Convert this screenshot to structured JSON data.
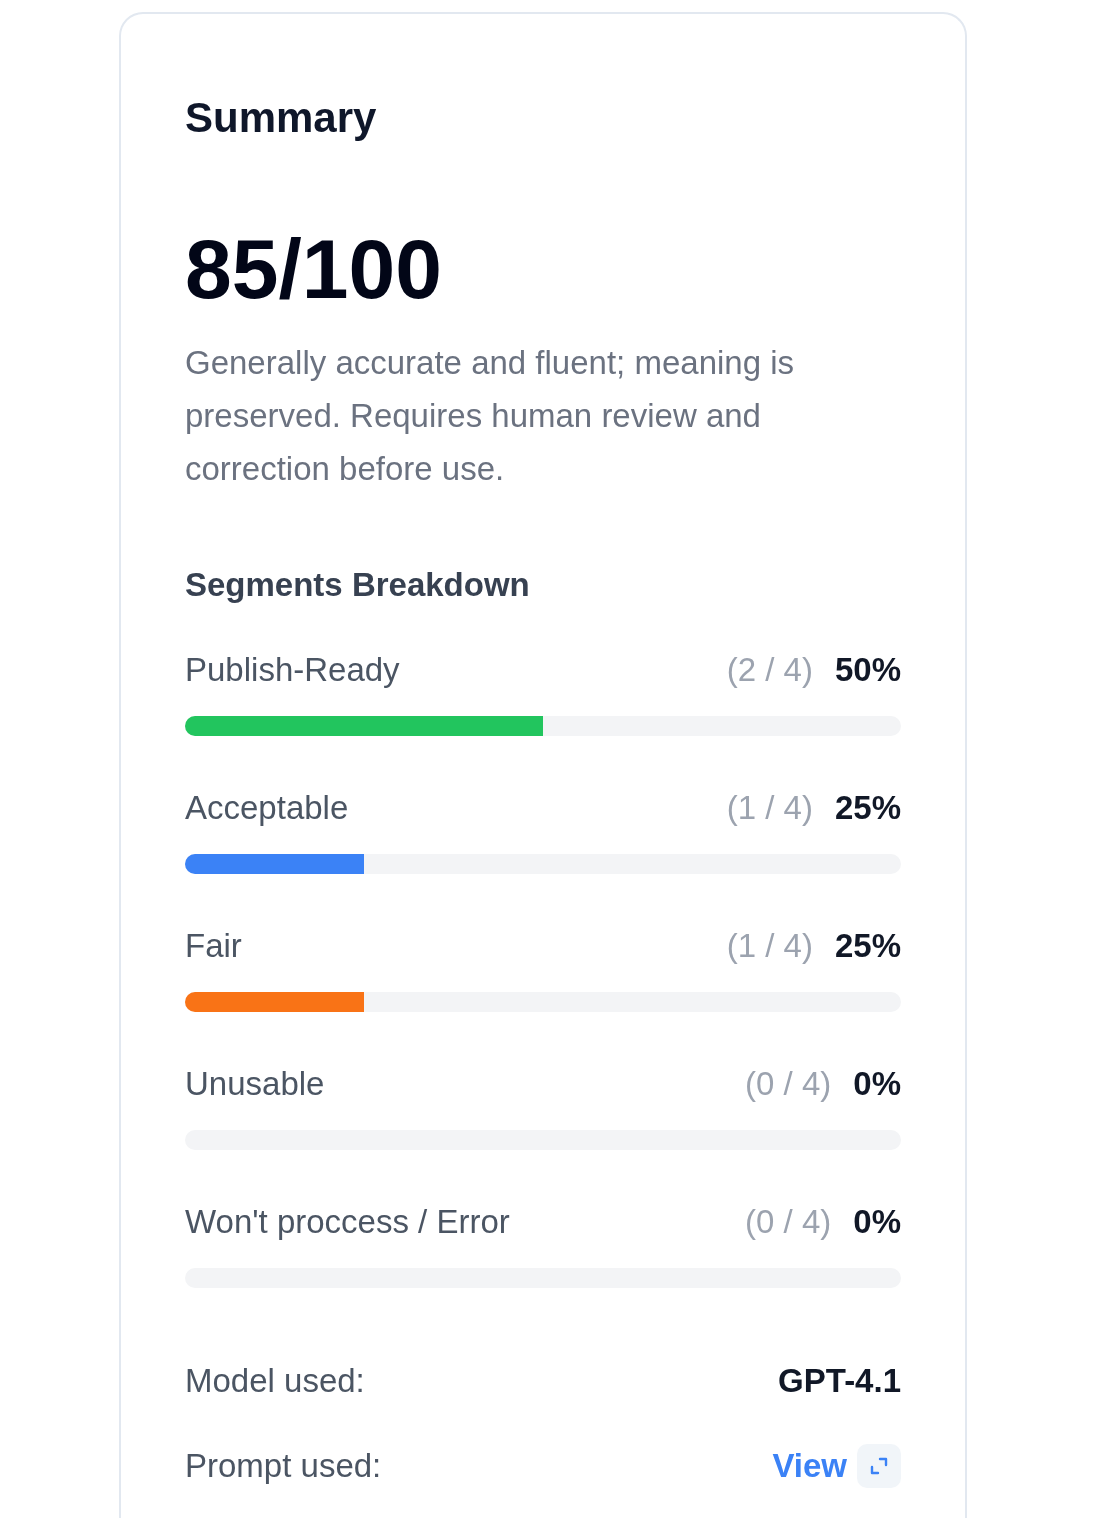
{
  "summary": {
    "title": "Summary",
    "score": "85/100",
    "description": "Generally accurate and fluent; meaning is preserved. Requires human review and correction before use."
  },
  "breakdown": {
    "title": "Segments Breakdown",
    "segments": [
      {
        "label": "Publish-Ready",
        "count": "(2 / 4)",
        "percent": "50%",
        "level": 0.5,
        "color": "#22c55e"
      },
      {
        "label": "Acceptable",
        "count": "(1 / 4)",
        "percent": "25%",
        "level": 0.25,
        "color": "#3b82f6"
      },
      {
        "label": "Fair",
        "count": "(1 / 4)",
        "percent": "25%",
        "level": 0.25,
        "color": "#f97316"
      },
      {
        "label": "Unusable",
        "count": "(0 / 4)",
        "percent": "0%"
      },
      {
        "label": "Won't proccess / Error",
        "count": "(0 / 4)",
        "percent": "0%"
      }
    ]
  },
  "details": [
    {
      "kind": "text",
      "label": "Model used:",
      "value": "GPT-4.1"
    },
    {
      "kind": "link",
      "label": "Prompt used:",
      "value": "View"
    }
  ]
}
